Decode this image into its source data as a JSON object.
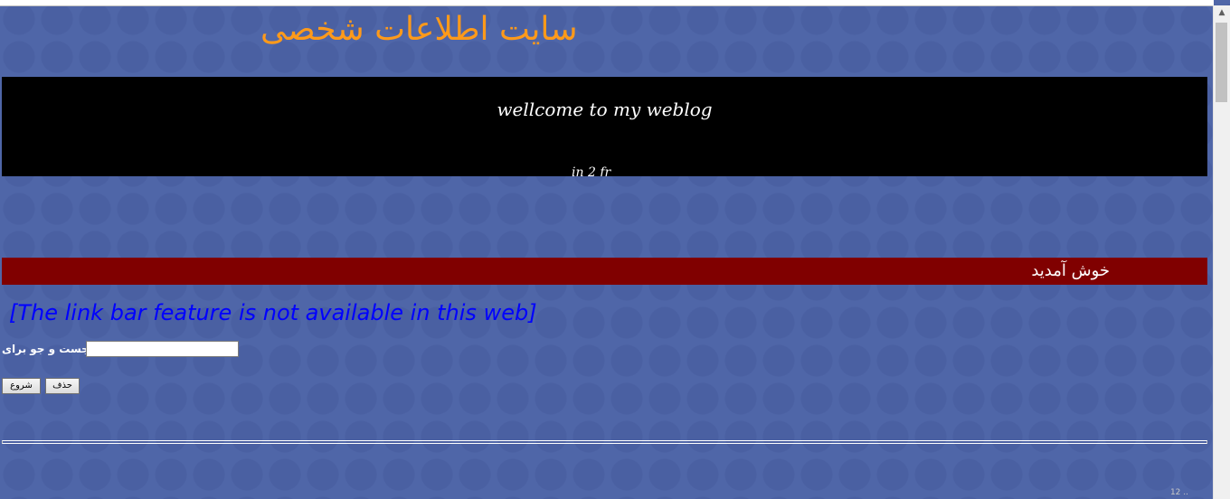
{
  "site_title": "سایت اطلاعات شخصی",
  "banner": {
    "text": "wellcome to my weblog",
    "cut_text": "in 2 fr"
  },
  "welcome": "خوش آمدید",
  "linkbar_message": "[The link bar feature is not available in this web]",
  "search": {
    "label": "جست و جو برای",
    "value": "",
    "start_button": "شروع",
    "delete_button": "حذف"
  },
  "footer_note": "12 ..",
  "colors": {
    "background": "#4f66a8",
    "title": "#ff9a1a",
    "banner": "#000000",
    "welcome_bar": "#800000",
    "linkbar_text": "#0000ff"
  },
  "icons": {
    "scroll_up": "triangle-up"
  }
}
